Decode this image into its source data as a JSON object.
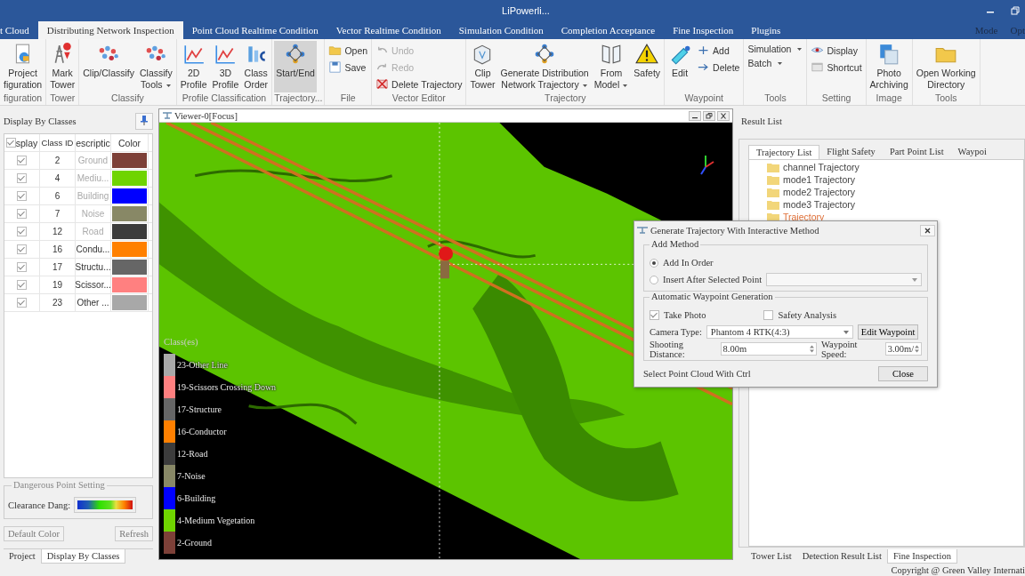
{
  "window": {
    "title": "LiPowerli..."
  },
  "menu_tabs": [
    {
      "label": "t Cloud",
      "selected": false
    },
    {
      "label": "Distributing Network Inspection",
      "selected": true
    },
    {
      "label": "Point Cloud Realtime Condition",
      "selected": false
    },
    {
      "label": "Vector Realtime Condition",
      "selected": false
    },
    {
      "label": "Simulation Condition",
      "selected": false
    },
    {
      "label": "Completion Acceptance",
      "selected": false
    },
    {
      "label": "Fine Inspection",
      "selected": false
    },
    {
      "label": "Plugins",
      "selected": false
    }
  ],
  "menu_right": [
    "Mode",
    "Opt"
  ],
  "ribbon": [
    {
      "label": "figuration",
      "buttons": [
        {
          "kind": "large",
          "label": "Project\nfiguration",
          "dropdown": false,
          "pressed": false,
          "disabled": false
        }
      ]
    },
    {
      "label": "Tower",
      "buttons": [
        {
          "kind": "large",
          "label": "Mark\nTower",
          "dropdown": false,
          "pressed": false,
          "disabled": false
        }
      ]
    },
    {
      "label": "Classify",
      "buttons": [
        {
          "kind": "large",
          "label": "Clip/Classify",
          "dropdown": false,
          "pressed": false,
          "disabled": false
        },
        {
          "kind": "large",
          "label": "Classify\nTools",
          "dropdown": true,
          "pressed": false,
          "disabled": false
        }
      ]
    },
    {
      "label": "Profile Classification",
      "buttons": [
        {
          "kind": "large",
          "label": "2D\nProfile",
          "dropdown": false,
          "pressed": false,
          "disabled": false
        },
        {
          "kind": "large",
          "label": "3D\nProfile",
          "dropdown": false,
          "pressed": false,
          "disabled": false
        },
        {
          "kind": "large",
          "label": "Class\nOrder",
          "dropdown": false,
          "pressed": false,
          "disabled": false
        }
      ]
    },
    {
      "label": "Trajectory...",
      "buttons": [
        {
          "kind": "large",
          "label": "Start/End",
          "dropdown": false,
          "pressed": true,
          "disabled": false
        }
      ]
    },
    {
      "label": "File",
      "buttons": [
        {
          "kind": "small",
          "label": "Open",
          "dropdown": false,
          "pressed": false,
          "disabled": false
        },
        {
          "kind": "small",
          "label": "Save",
          "dropdown": false,
          "pressed": false,
          "disabled": false
        }
      ]
    },
    {
      "label": "Vector Editor",
      "buttons": [
        {
          "kind": "small",
          "label": "Undo",
          "dropdown": false,
          "pressed": false,
          "disabled": true
        },
        {
          "kind": "small",
          "label": "Redo",
          "dropdown": false,
          "pressed": false,
          "disabled": true
        },
        {
          "kind": "small",
          "label": "Delete Trajectory",
          "dropdown": false,
          "pressed": false,
          "disabled": false
        }
      ]
    },
    {
      "label": "Trajectory",
      "buttons": [
        {
          "kind": "large",
          "label": "Clip\nTower",
          "dropdown": false,
          "pressed": false,
          "disabled": false
        },
        {
          "kind": "large",
          "label": "Generate Distribution\nNetwork Trajectory",
          "dropdown": true,
          "pressed": false,
          "disabled": false
        },
        {
          "kind": "large",
          "label": "From\nModel",
          "dropdown": true,
          "pressed": false,
          "disabled": false
        },
        {
          "kind": "large",
          "label": "Safety",
          "dropdown": false,
          "pressed": false,
          "disabled": false
        }
      ]
    },
    {
      "label": "Waypoint",
      "buttons": [
        {
          "kind": "large",
          "label": "Edit",
          "dropdown": false,
          "pressed": false,
          "disabled": false
        },
        {
          "kind": "small",
          "label": "Add",
          "dropdown": false,
          "pressed": false,
          "disabled": false
        },
        {
          "kind": "small",
          "label": "Delete",
          "dropdown": false,
          "pressed": false,
          "disabled": false
        }
      ]
    },
    {
      "label": "Tools",
      "buttons": [
        {
          "kind": "small",
          "label": "Simulation",
          "dropdown": true,
          "pressed": false,
          "disabled": false
        },
        {
          "kind": "small",
          "label": "Batch",
          "dropdown": true,
          "pressed": false,
          "disabled": false
        }
      ]
    },
    {
      "label": "Setting",
      "buttons": [
        {
          "kind": "small",
          "label": "Display",
          "dropdown": false,
          "pressed": false,
          "disabled": false
        },
        {
          "kind": "small",
          "label": "Shortcut",
          "dropdown": false,
          "pressed": false,
          "disabled": false
        }
      ]
    },
    {
      "label": "Image",
      "buttons": [
        {
          "kind": "large",
          "label": "Photo\nArchiving",
          "dropdown": false,
          "pressed": false,
          "disabled": false
        }
      ]
    },
    {
      "label": "Tools",
      "buttons": [
        {
          "kind": "large",
          "label": "Open Working\nDirectory",
          "dropdown": false,
          "pressed": false,
          "disabled": false
        }
      ]
    }
  ],
  "class_panel": {
    "title": "Display By Classes",
    "columns": [
      {
        "label": "splay",
        "checked": true
      },
      {
        "label": "Class ID"
      },
      {
        "label": "escriptic"
      },
      {
        "label": "Color"
      }
    ],
    "rows": [
      {
        "visible": true,
        "id": "2",
        "description": "Ground",
        "greyed": true,
        "color": "#7d4038"
      },
      {
        "visible": true,
        "id": "4",
        "description": "Mediu...",
        "greyed": true,
        "color": "#6fd400"
      },
      {
        "visible": true,
        "id": "6",
        "description": "Building",
        "greyed": true,
        "color": "#0000ff"
      },
      {
        "visible": true,
        "id": "7",
        "description": "Noise",
        "greyed": true,
        "color": "#888866"
      },
      {
        "visible": true,
        "id": "12",
        "description": "Road",
        "greyed": true,
        "color": "#3c3c3c"
      },
      {
        "visible": true,
        "id": "16",
        "description": "Condu...",
        "greyed": false,
        "color": "#ff8000"
      },
      {
        "visible": true,
        "id": "17",
        "description": "Structu...",
        "greyed": false,
        "color": "#666666"
      },
      {
        "visible": true,
        "id": "19",
        "description": "Scissor...",
        "greyed": false,
        "color": "#ff8080"
      },
      {
        "visible": true,
        "id": "23",
        "description": "Other ...",
        "greyed": false,
        "color": "#a8a8a8"
      }
    ],
    "danger": {
      "title": "Dangerous Point Setting",
      "label": "Clearance Dang:"
    },
    "buttons": [
      "Default Color",
      "Refresh"
    ],
    "tabs": [
      {
        "label": "Project",
        "selected": false
      },
      {
        "label": "Display By Classes",
        "selected": true
      }
    ]
  },
  "viewer": {
    "title": "Viewer-0[Focus]",
    "legend_title": "Class(es)",
    "legend": [
      {
        "label": "23-Other Line",
        "color": "#a8a8a8"
      },
      {
        "label": "19-Scissors Crossing Down",
        "color": "#ff8080"
      },
      {
        "label": "17-Structure",
        "color": "#666666"
      },
      {
        "label": "16-Conductor",
        "color": "#ff8000"
      },
      {
        "label": "12-Road",
        "color": "#3c3c3c"
      },
      {
        "label": "7-Noise",
        "color": "#888866"
      },
      {
        "label": "6-Building",
        "color": "#0000ff"
      },
      {
        "label": "4-Medium Vegetation",
        "color": "#6fd400"
      },
      {
        "label": "2-Ground",
        "color": "#7d4038"
      }
    ]
  },
  "result_panel": {
    "title": "Result List",
    "tabs": [
      {
        "label": "Trajectory List",
        "selected": true
      },
      {
        "label": "Flight Safety",
        "selected": false
      },
      {
        "label": "Part Point List",
        "selected": false
      },
      {
        "label": "Waypoi",
        "selected": false
      }
    ],
    "tree": [
      {
        "label": "channel Trajectory",
        "selected": false
      },
      {
        "label": "mode1 Trajectory",
        "selected": false
      },
      {
        "label": "mode2 Trajectory",
        "selected": false
      },
      {
        "label": "mode3 Trajectory",
        "selected": false
      },
      {
        "label": "Trajectory",
        "selected": true
      }
    ],
    "bottom_tabs": [
      {
        "label": "Tower List",
        "selected": false
      },
      {
        "label": "Detection Result List",
        "selected": false
      },
      {
        "label": "Fine Inspection",
        "selected": true
      }
    ]
  },
  "dialog": {
    "title": "Generate Trajectory With Interactive Method",
    "add_method": {
      "title": "Add Method",
      "options": [
        {
          "label": "Add In Order",
          "selected": true
        },
        {
          "label": "Insert After Selected Point",
          "selected": false
        }
      ]
    },
    "auto": {
      "title": "Automatic Waypoint Generation",
      "checks": [
        {
          "label": "Take Photo",
          "checked": true
        },
        {
          "label": "Safety Analysis",
          "checked": false
        }
      ],
      "camera_label": "Camera Type:",
      "camera_value": "Phantom 4 RTK(4:3)",
      "edit_button": "Edit Waypoint",
      "distance_label": "Shooting Distance:",
      "distance_value": "8.00m",
      "speed_label": "Waypoint Speed:",
      "speed_value": "3.00m/"
    },
    "hint": "Select Point Cloud With Ctrl",
    "close_button": "Close"
  },
  "status_bar": {
    "copyright": "Copyright @ Green Valley Internati"
  }
}
